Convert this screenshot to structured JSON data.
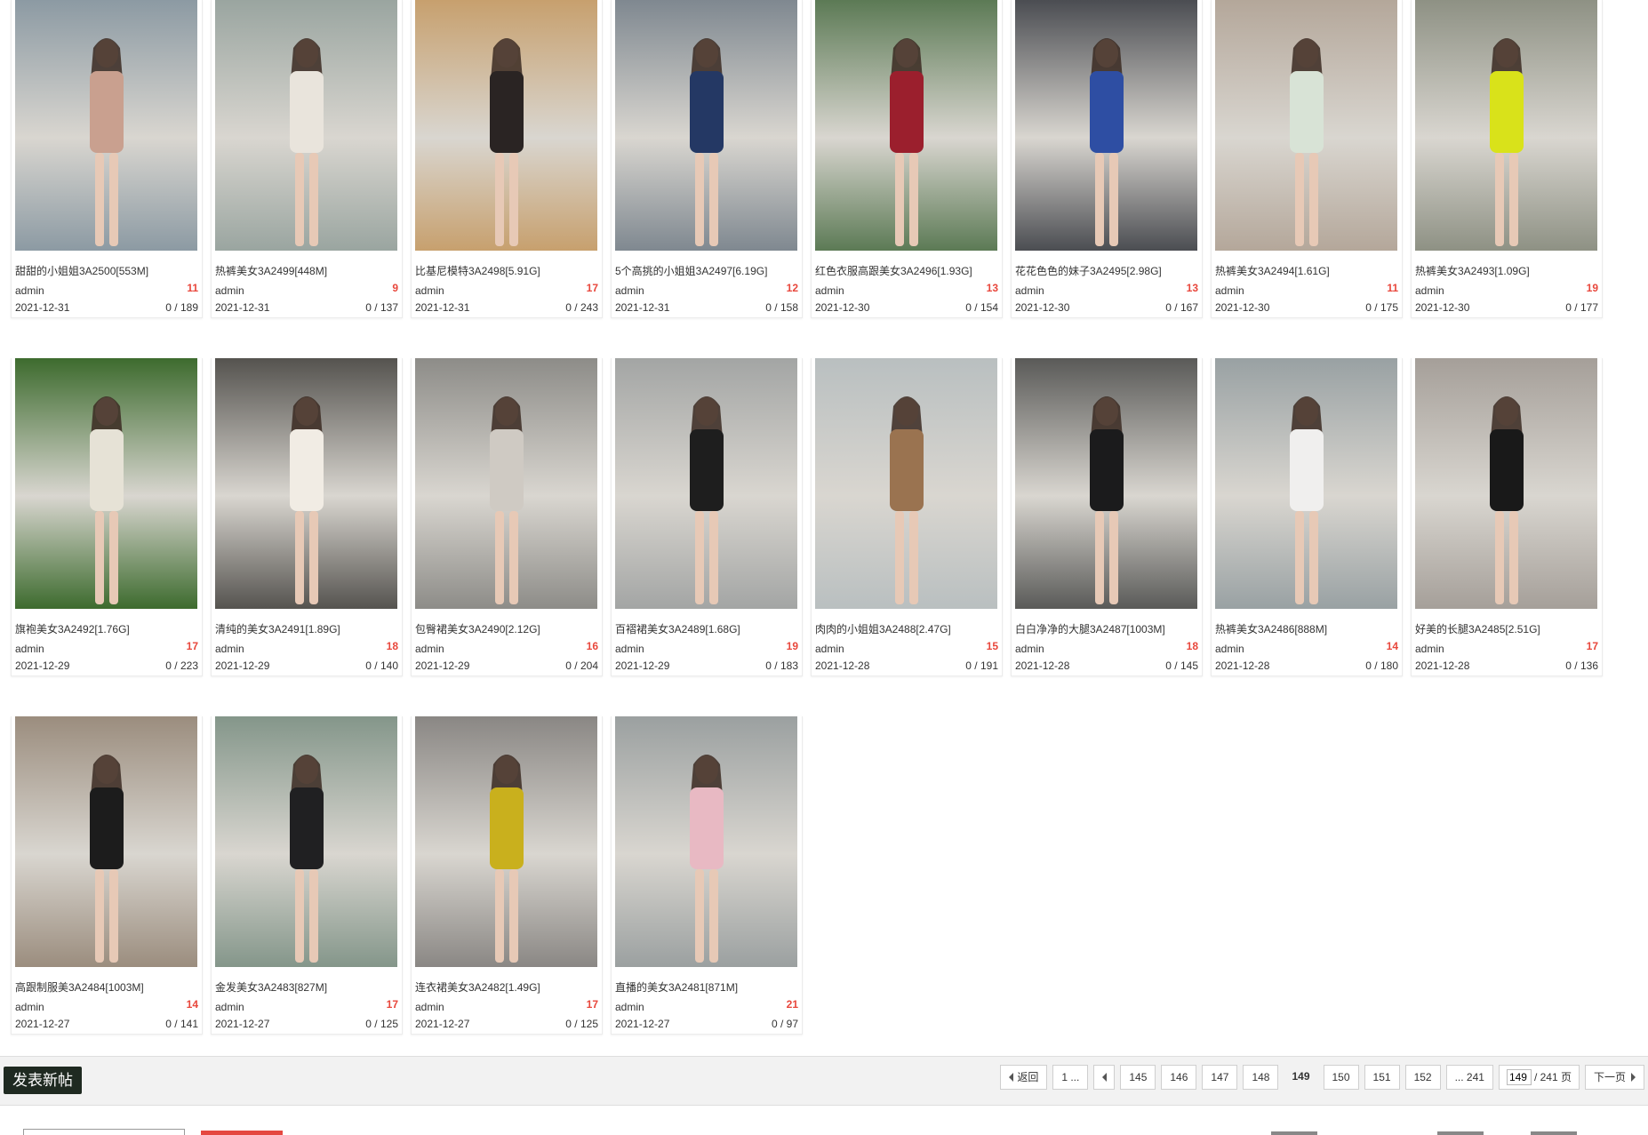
{
  "cards": [
    {
      "title": "甜甜的小姐姐3A2500[553M]",
      "author": "admin",
      "likes": "11",
      "date": "2021-12-31",
      "stats": "0 / 189",
      "palette": [
        "#8c9aa3",
        "#c9a08f"
      ]
    },
    {
      "title": "热裤美女3A2499[448M]",
      "author": "admin",
      "likes": "9",
      "date": "2021-12-31",
      "stats": "0 / 137",
      "palette": [
        "#9aa5a0",
        "#e9e4dc"
      ]
    },
    {
      "title": "比基尼模特3A2498[5.91G]",
      "author": "admin",
      "likes": "17",
      "date": "2021-12-31",
      "stats": "0 / 243",
      "palette": [
        "#c7a06e",
        "#2a2423"
      ]
    },
    {
      "title": "5个高挑的小姐姐3A2497[6.19G]",
      "author": "admin",
      "likes": "12",
      "date": "2021-12-31",
      "stats": "0 / 158",
      "palette": [
        "#7f8890",
        "#243864"
      ]
    },
    {
      "title": "红色衣服高跟美女3A2496[1.93G]",
      "author": "admin",
      "likes": "13",
      "date": "2021-12-30",
      "stats": "0 / 154",
      "palette": [
        "#5c7a55",
        "#9b1f2d"
      ]
    },
    {
      "title": "花花色色的妹子3A2495[2.98G]",
      "author": "admin",
      "likes": "13",
      "date": "2021-12-30",
      "stats": "0 / 167",
      "palette": [
        "#4b4d52",
        "#2e4ea3"
      ]
    },
    {
      "title": "热裤美女3A2494[1.61G]",
      "author": "admin",
      "likes": "11",
      "date": "2021-12-30",
      "stats": "0 / 175",
      "palette": [
        "#b4a79a",
        "#d8e3d6"
      ]
    },
    {
      "title": "热裤美女3A2493[1.09G]",
      "author": "admin",
      "likes": "19",
      "date": "2021-12-30",
      "stats": "0 / 177",
      "palette": [
        "#8e9184",
        "#d9e21a"
      ]
    },
    {
      "title": "旗袍美女3A2492[1.76G]",
      "author": "admin",
      "likes": "17",
      "date": "2021-12-29",
      "stats": "0 / 223",
      "palette": [
        "#3d6b2e",
        "#e6e2d6"
      ]
    },
    {
      "title": "清纯的美女3A2491[1.89G]",
      "author": "admin",
      "likes": "18",
      "date": "2021-12-29",
      "stats": "0 / 140",
      "palette": [
        "#55534f",
        "#f1ece4"
      ]
    },
    {
      "title": "包臀裙美女3A2490[2.12G]",
      "author": "admin",
      "likes": "16",
      "date": "2021-12-29",
      "stats": "0 / 204",
      "palette": [
        "#8d8c88",
        "#cfcac3"
      ]
    },
    {
      "title": "百褶裙美女3A2489[1.68G]",
      "author": "admin",
      "likes": "19",
      "date": "2021-12-29",
      "stats": "0 / 183",
      "palette": [
        "#a3a5a4",
        "#1e1e1e"
      ]
    },
    {
      "title": "肉肉的小姐姐3A2488[2.47G]",
      "author": "admin",
      "likes": "15",
      "date": "2021-12-28",
      "stats": "0 / 191",
      "palette": [
        "#b9bfc0",
        "#9a7350"
      ]
    },
    {
      "title": "白白净净的大腿3A2487[1003M]",
      "author": "admin",
      "likes": "18",
      "date": "2021-12-28",
      "stats": "0 / 145",
      "palette": [
        "#5a5a58",
        "#1b1b1c"
      ]
    },
    {
      "title": "热裤美女3A2486[888M]",
      "author": "admin",
      "likes": "14",
      "date": "2021-12-28",
      "stats": "0 / 180",
      "palette": [
        "#99a1a3",
        "#f0efee"
      ]
    },
    {
      "title": "好美的长腿3A2485[2.51G]",
      "author": "admin",
      "likes": "17",
      "date": "2021-12-28",
      "stats": "0 / 136",
      "palette": [
        "#a59f99",
        "#191919"
      ]
    },
    {
      "title": "高跟制服美3A2484[1003M]",
      "author": "admin",
      "likes": "14",
      "date": "2021-12-27",
      "stats": "0 / 141",
      "palette": [
        "#9b8d7e",
        "#1c1c1c"
      ]
    },
    {
      "title": "金发美女3A2483[827M]",
      "author": "admin",
      "likes": "17",
      "date": "2021-12-27",
      "stats": "0 / 125",
      "palette": [
        "#84968a",
        "#202022"
      ]
    },
    {
      "title": "连衣裙美女3A2482[1.49G]",
      "author": "admin",
      "likes": "17",
      "date": "2021-12-27",
      "stats": "0 / 125",
      "palette": [
        "#8a8784",
        "#c9b01d"
      ]
    },
    {
      "title": "直播的美女3A2481[871M]",
      "author": "admin",
      "likes": "21",
      "date": "2021-12-27",
      "stats": "0 / 97",
      "palette": [
        "#9ba0a0",
        "#e8b9c3"
      ]
    }
  ],
  "toolbar": {
    "new_post_label": "发表新帖"
  },
  "pager": {
    "back_label": "返回",
    "first_label": "1 ...",
    "pages": [
      "145",
      "146",
      "147",
      "148",
      "149",
      "150",
      "151",
      "152"
    ],
    "current": "149",
    "last_label": "... 241",
    "jump_value": "149",
    "total_label": "/ 241 页",
    "next_label": "下一页"
  }
}
